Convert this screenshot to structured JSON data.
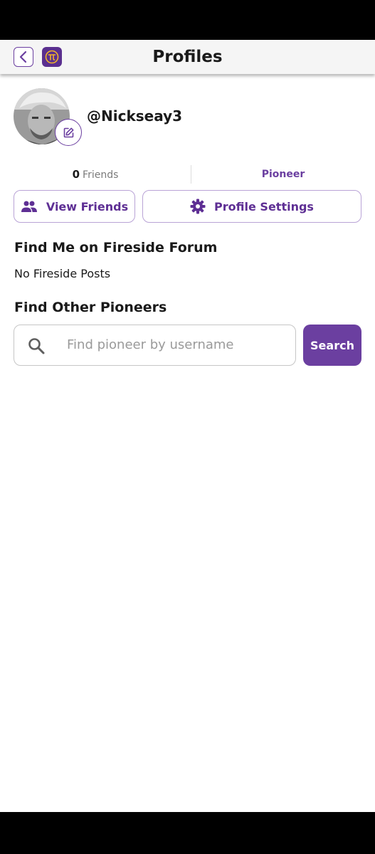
{
  "header": {
    "title": "Profiles",
    "back_icon": "chevron-left-icon",
    "logo_icon": "pi-logo-icon"
  },
  "profile": {
    "username": "@Nickseay3",
    "friends_count": "0",
    "friends_label": "Friends",
    "role": "Pioneer",
    "edit_icon": "edit-icon"
  },
  "actions": {
    "view_friends_label": "View Friends",
    "view_friends_icon": "people-icon",
    "profile_settings_label": "Profile Settings",
    "profile_settings_icon": "gear-icon"
  },
  "forum": {
    "heading": "Find Me on Fireside Forum",
    "empty_text": "No Fireside Posts"
  },
  "find_pioneers": {
    "heading": "Find Other Pioneers",
    "placeholder": "Find pioneer by username",
    "value": "",
    "search_label": "Search"
  },
  "colors": {
    "accent": "#6b3fa0",
    "accent_border": "#b9a3d6",
    "logo_bg": "#5a2f8f",
    "logo_fg": "#f0b429"
  }
}
